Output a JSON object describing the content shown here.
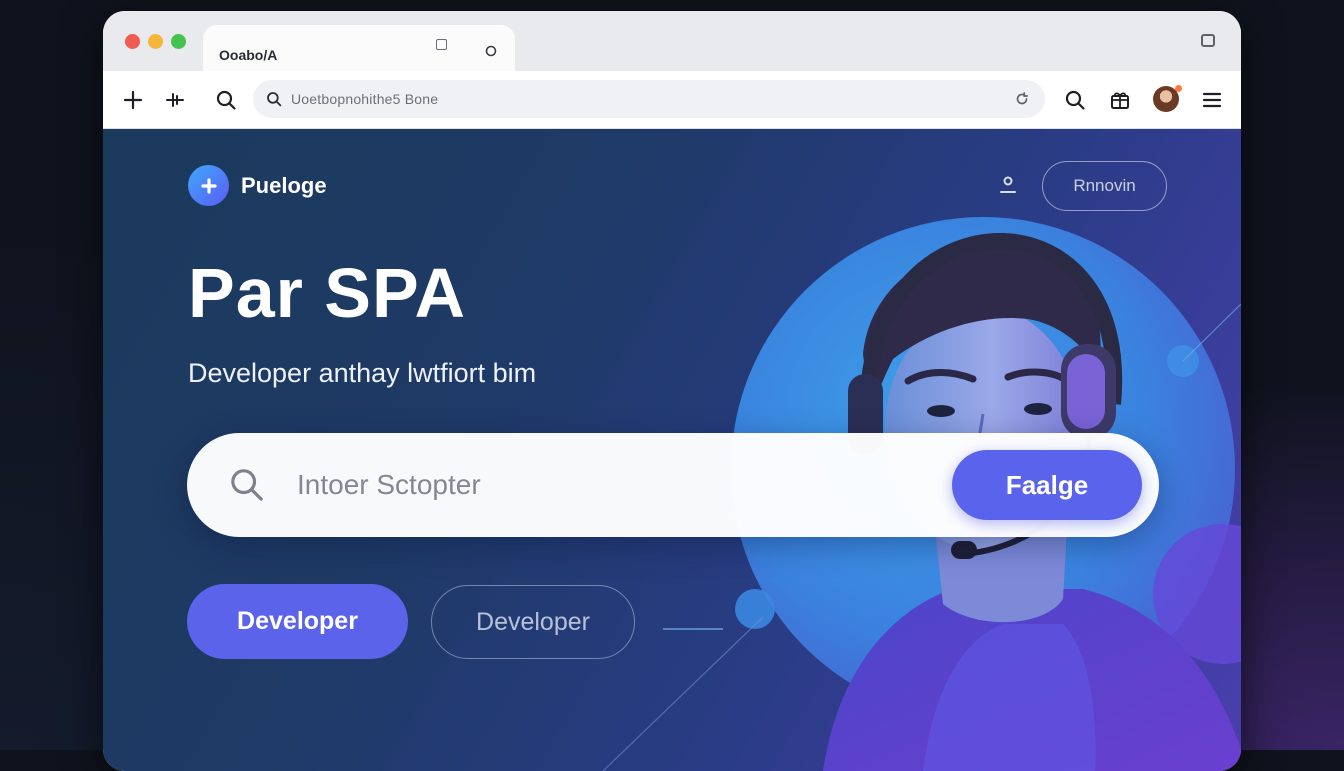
{
  "browser": {
    "tab_title": "Ooabo/A",
    "tab_close_icon": "close-icon",
    "url": "Uoetbopnohithe5 Bone"
  },
  "site": {
    "brand_name": "Pueloge",
    "header_button": "Rnnovin",
    "headline": "Par SPA",
    "subheadline": "Developer anthay lwtfiort bim",
    "search": {
      "placeholder": "Intoer Sctopter",
      "button": "Faalge"
    },
    "primary_button": "Developer",
    "secondary_button": "Developer"
  },
  "colors": {
    "accent": "#5a63ec",
    "hero_start": "#1c3a5c",
    "hero_end": "#4a3fae"
  }
}
